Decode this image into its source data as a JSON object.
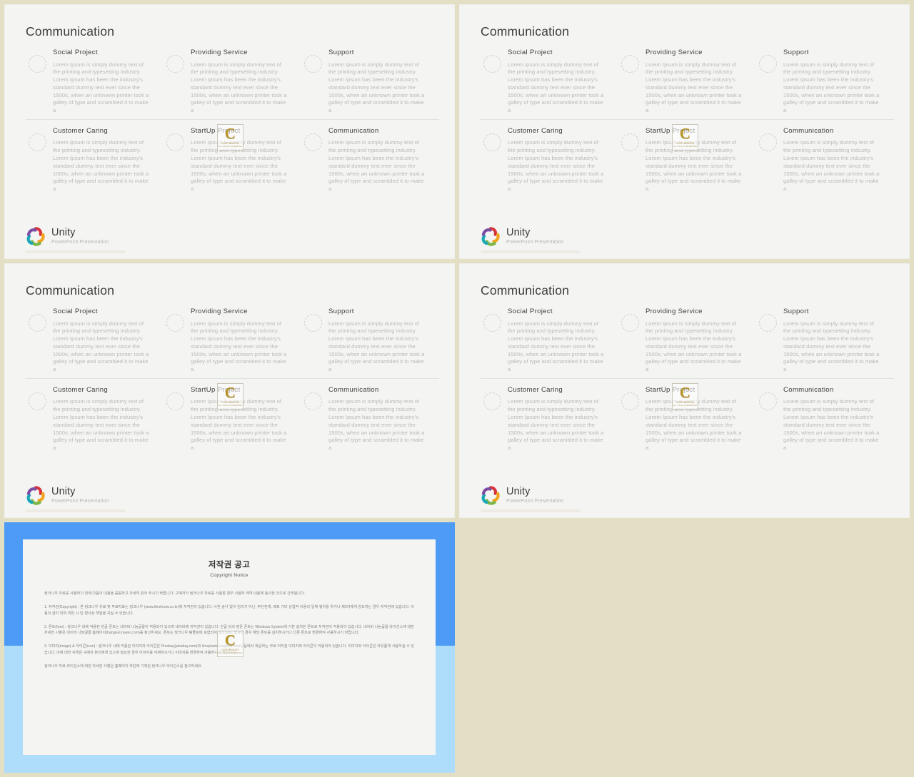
{
  "theme": {
    "page_background": "#e3dfc4",
    "slide_background": "#f4f4f3",
    "accent_blue": "#4d9bf5",
    "accent_blue_light": "#aedcfb",
    "title_color": "#3d3d3d",
    "body_color": "#b9b9b7"
  },
  "watermark": {
    "letter": "C",
    "line1": "COPYRIGHTS",
    "line2": "ALL RIGHTS RESERVED"
  },
  "slide": {
    "title": "Communication",
    "footer": {
      "logo_icon": "pinwheel-star-logo",
      "brand": "Unity",
      "tagline": "PowerPoint Presentation"
    },
    "items": [
      {
        "icon": "dashed-circle-icon",
        "heading": "Social Project",
        "body": "Lorem Ipsum is simply dummy text of the printing and typesetting industry. Lorem Ipsum has been the industry's standard dummy text ever since the 1500s, when an unknown printer took a galley of type and scrambled it to make a"
      },
      {
        "icon": "dashed-circle-icon",
        "heading": "Providing  Service",
        "body": "Lorem Ipsum is simply dummy text of the printing and typesetting industry. Lorem Ipsum has been the industry's standard dummy text ever since the 1500s, when an unknown printer took a galley of type and scrambled it to make a"
      },
      {
        "icon": "dashed-circle-icon",
        "heading": "Support",
        "body": "Lorem Ipsum is simply dummy text of the printing and typesetting industry. Lorem Ipsum has been the industry's standard dummy text ever since the 1500s, when an unknown printer took a galley of type and scrambled it to make a"
      },
      {
        "icon": "dashed-circle-icon",
        "heading": "Customer Caring",
        "body": "Lorem Ipsum is simply dummy text of the printing and typesetting industry. Lorem Ipsum has been the industry's standard dummy text ever since the 1500s, when an unknown printer took a galley of type and scrambled it to make a"
      },
      {
        "icon": "dashed-circle-icon",
        "heading": "StartUp Project",
        "body": "Lorem Ipsum is simply dummy text of the printing and typesetting industry. Lorem Ipsum has been the industry's standard dummy text ever since the 1500s, when an unknown printer took a galley of type and scrambled it to make a"
      },
      {
        "icon": "dashed-circle-icon",
        "heading": "Communication",
        "body": "Lorem Ipsum is simply dummy text of the printing and typesetting industry. Lorem Ipsum has been the industry's standard dummy text ever since the 1500s, when an unknown printer took a galley of type and scrambled it to make a"
      }
    ]
  },
  "copyright_slide": {
    "title": "저작권 공고",
    "subtitle": "Copyright Notice",
    "paragraphs": [
      "씽크나우 자료를 사용하기 전에 다음의 내용을 꼼꼼하고 자세히 읽어 주시기 바랍니다. 구매자가 씽크나우 자료를 사용할 경우 사용자 계약 내용에 동의한 것으로 간주됩니다.",
      "1. 저작권(Copyright) : 본 씽크나우 유료 및 무료자료는 씽크나우 (www.thinknow.co.kr)에 저작권이 있습니다. 사전 승낙 없이 임의가 아닌, 무단전재, 배포 기타 상업적 이용의 일체 행위를 하거나 제3자에게 양도하는 경우 저작권에 있습니다. 이용이 금지 되며 위반 시 민·형사상 책임을 지실 수 있습니다.",
      "2. 폰트(font) : 씽크나우 내에 적용된 한글 폰트는 네이버 나눔글꼴이 적용되어 있으며 네이버에 저작권이 있습니다. 한글 외의 영문 폰트는 Windows System에 기본 설치된 폰트로 저작권이 적용되어 있습니다. 네이버 나눔글꼴 라이선스에 대한 자세한 사항은 네이버 나눔글꼴 홈페이지(hangeul.naver.com)를 참고하세요. 폰트는 씽크나우 템플릿에 포함되지 않으므로, 필요한 경우 해당 폰트를 설치하시거나 다른 폰트로 변경하여 사용하시기 바랍니다.",
      "3. 이미지(image) & 아이콘(icon) : 씽크나우 내에 적용된 이미지와 아이콘은 Pixabay(pixabay.com)와 Unsplash(unsplash.com) 등에서 제공하는 무료 저작권 이미지와 아이콘이 적용되어 있습니다. 이미지와 아이콘은 자유롭게 사용하실 수 있습니다. 이에 대한 귀책은 구매자 본인에게 있으며 필요한 경우 이미지를 삭제하시거나 이미지를 변경하여 사용하시기 바랍니다.",
      "씽크나우 자료 라이선스에 대한 자세한 사항은 홈페이지 하단에 기재된 씽크나우 라이선스를 참고하세요."
    ]
  }
}
